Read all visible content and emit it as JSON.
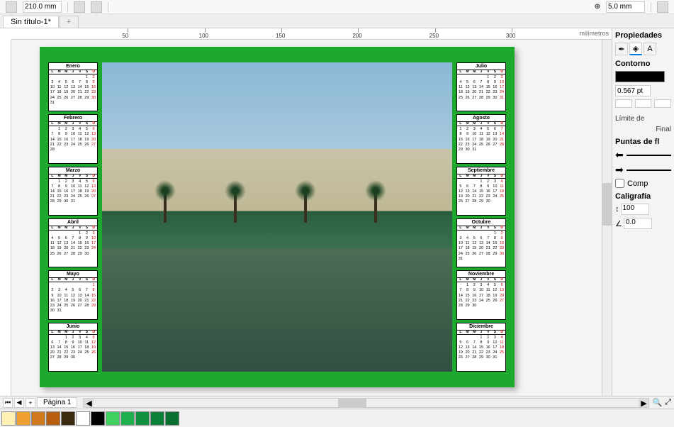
{
  "toolbar": {
    "page_width": "210.0 mm",
    "nudge": "5.0 mm"
  },
  "tabs": {
    "doc": "Sin título-1*"
  },
  "ruler": {
    "units": "milímetros",
    "marks": [
      50,
      100,
      150,
      200,
      250,
      300
    ]
  },
  "status": {
    "page_label": "Página 1"
  },
  "palette": [
    "#fff0b3",
    "#f0a030",
    "#d07820",
    "#b85e10",
    "#3a2a10",
    "#ffffff",
    "#000000",
    "#40d060",
    "#20b050",
    "#109040",
    "#0a8038",
    "#087030"
  ],
  "panel": {
    "title": "Propiedades",
    "section": "Contorno",
    "stroke": "0.567 pt",
    "limit": "Límite de",
    "final": "Final",
    "arrowheads": "Puntas de fl",
    "share": "Comp",
    "calligraphy": "Caligrafía",
    "val1": "100",
    "val2": "0.0"
  },
  "days": [
    "L",
    "M",
    "M",
    "J",
    "V",
    "S",
    "D"
  ],
  "months_left": [
    {
      "name": "Enero",
      "start": 5,
      "days": 31
    },
    {
      "name": "Febrero",
      "start": 1,
      "days": 28
    },
    {
      "name": "Marzo",
      "start": 1,
      "days": 31
    },
    {
      "name": "Abril",
      "start": 4,
      "days": 30
    },
    {
      "name": "Mayo",
      "start": 6,
      "days": 31
    },
    {
      "name": "Junio",
      "start": 2,
      "days": 30
    }
  ],
  "months_right": [
    {
      "name": "Julio",
      "start": 4,
      "days": 31
    },
    {
      "name": "Agosto",
      "start": 0,
      "days": 31
    },
    {
      "name": "Septiembre",
      "start": 3,
      "days": 30
    },
    {
      "name": "Octubre",
      "start": 5,
      "days": 31
    },
    {
      "name": "Noviembre",
      "start": 1,
      "days": 30
    },
    {
      "name": "Diciembre",
      "start": 3,
      "days": 31
    }
  ]
}
